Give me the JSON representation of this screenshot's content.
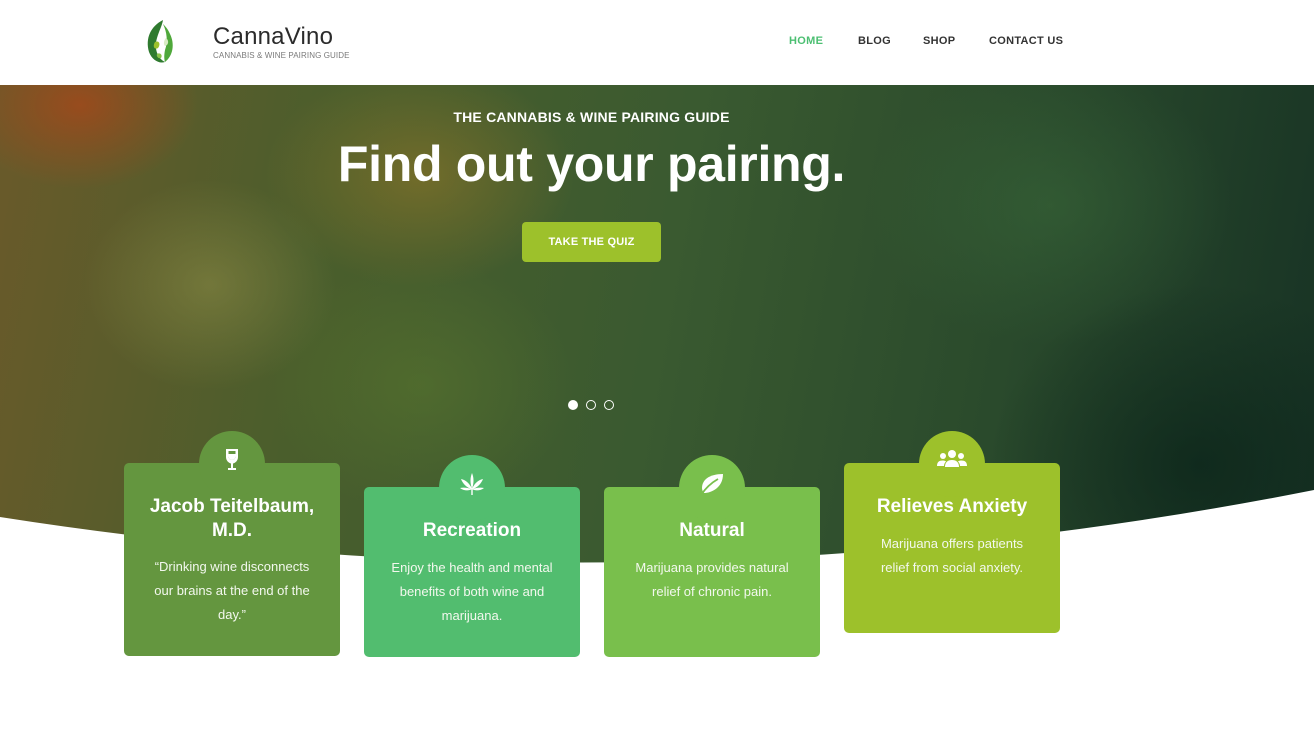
{
  "brand": {
    "name": "CannaVino",
    "tagline": "CANNABIS & WINE PAIRING GUIDE",
    "logo_icon": "leaf-icon"
  },
  "nav": {
    "items": [
      {
        "label": "HOME",
        "active": true
      },
      {
        "label": "BLOG",
        "active": false
      },
      {
        "label": "SHOP",
        "active": false
      },
      {
        "label": "CONTACT US",
        "active": false
      }
    ]
  },
  "hero": {
    "eyebrow": "THE CANNABIS & WINE PAIRING GUIDE",
    "title": "Find out your pairing.",
    "cta_label": "TAKE THE QUIZ",
    "slides": 3,
    "active_slide": 1
  },
  "cards": [
    {
      "icon": "wine-glass-icon",
      "title": "Jacob Teitelbaum, M.D.",
      "text": "“Drinking wine disconnects our brains at the end of the day.”",
      "color": "#64963f"
    },
    {
      "icon": "cannabis-leaf-icon",
      "title": "Recreation",
      "text": "Enjoy the health and mental benefits of both wine and marijuana.",
      "color": "#52bd6f"
    },
    {
      "icon": "leaf-icon",
      "title": "Natural",
      "text": "Marijuana provides natural relief of chronic pain.",
      "color": "#79bf4c"
    },
    {
      "icon": "users-icon",
      "title": "Relieves Anxiety",
      "text": "Marijuana offers patients relief from social anxiety.",
      "color": "#9dc12b"
    }
  ],
  "colors": {
    "accent": "#4cbf72",
    "cta": "#9dc12b"
  }
}
